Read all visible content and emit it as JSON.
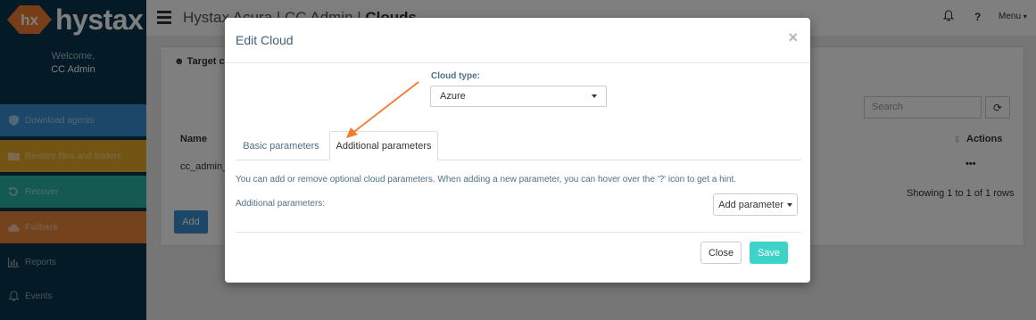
{
  "brand": {
    "name": "hystax",
    "mark": "hx",
    "color": "#f07c30"
  },
  "sidebar": {
    "welcome": "Welcome,",
    "user": "CC Admin",
    "items": [
      {
        "label": "Download agents",
        "icon": "shield-icon",
        "color": "#3a8fd0"
      },
      {
        "label": "Restore files and folders",
        "icon": "folder-icon",
        "color": "#e9a826"
      },
      {
        "label": "Recover",
        "icon": "recover-icon",
        "color": "#2bb3a6"
      },
      {
        "label": "Failback",
        "icon": "cloud-upload-icon",
        "color": "#e8843a"
      },
      {
        "label": "Reports",
        "icon": "bar-chart-icon"
      },
      {
        "label": "Events",
        "icon": "bell-icon"
      }
    ]
  },
  "topbar": {
    "title_prefix": "Hystax Acura | CC Admin | ",
    "title_bold": "Clouds",
    "help": "?",
    "menu": "Menu"
  },
  "background": {
    "panel_title": "Target cl",
    "search_placeholder": "Search",
    "col_name": "Name",
    "col_actions": "Actions",
    "row_name": "cc_admin_",
    "row_actions": "•••",
    "showing": "Showing 1 to 1 of 1 rows",
    "add": "Add"
  },
  "modal": {
    "title": "Edit Cloud",
    "close_symbol": "×",
    "cloud_type_label": "Cloud type:",
    "cloud_type_value": "Azure",
    "tabs": [
      {
        "label": "Basic parameters",
        "active": false
      },
      {
        "label": "Additional parameters",
        "active": true
      }
    ],
    "hint": "You can add or remove optional cloud parameters. When adding a new parameter, you can hover over the '?' icon to get a hint.",
    "additional_label": "Additional parameters:",
    "add_parameter": "Add parameter",
    "close_button": "Close",
    "save_button": "Save"
  },
  "colors": {
    "accent": "#3dd3c8",
    "sidebar_bg": "#08364f",
    "arrow": "#f07c30"
  }
}
